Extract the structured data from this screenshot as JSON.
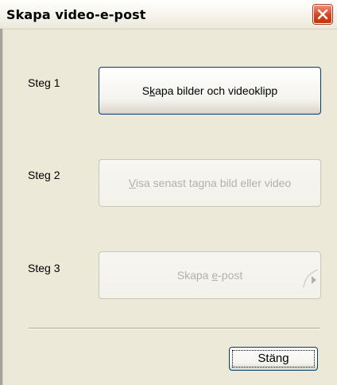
{
  "window": {
    "title": "Skapa video-e-post"
  },
  "steps": [
    {
      "label": "Steg 1",
      "button_before": "S",
      "button_accel": "k",
      "button_after": "apa bilder och videoklipp",
      "enabled": true
    },
    {
      "label": "Steg 2",
      "button_before": "",
      "button_accel": "V",
      "button_after": "isa senast tagna bild eller video",
      "enabled": false
    },
    {
      "label": "Steg 3",
      "button_before": "Skapa ",
      "button_accel": "e",
      "button_after": "-post",
      "enabled": false
    }
  ],
  "footer": {
    "close_label": "Stäng"
  },
  "icons": {
    "close": "close-icon",
    "send": "send-arrow-icon"
  },
  "colors": {
    "dialog_background": "#ece9d8",
    "close_button_red": "#d6441e",
    "disabled_text": "#b4b2a8",
    "button_border": "#003c74"
  }
}
